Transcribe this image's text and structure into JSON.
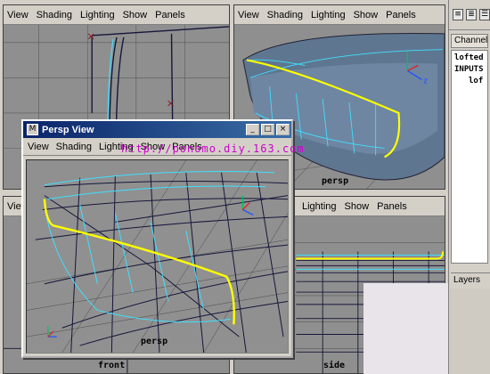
{
  "panels": {
    "top_left": {
      "menu": [
        "View",
        "Shading",
        "Lighting",
        "Show",
        "Panels"
      ]
    },
    "top_right": {
      "menu": [
        "View",
        "Shading",
        "Lighting",
        "Show",
        "Panels"
      ],
      "camera_label": "persp"
    },
    "bottom_left": {
      "menu": [
        "View"
      ],
      "camera_label": "front"
    },
    "bottom_right": {
      "menu": [
        "Lighting",
        "Show",
        "Panels"
      ],
      "camera_label": "side"
    }
  },
  "channel_box": {
    "icons": [
      "channels-icon",
      "attributes-icon",
      "list-icon"
    ],
    "tab_label": "Channels",
    "lines": [
      "lofted",
      "INPUTS",
      "lof"
    ],
    "layers_label": "Layers"
  },
  "floating_window": {
    "title": "Persp View",
    "buttons": [
      "_",
      "□",
      "×"
    ],
    "menu": [
      "View",
      "Shading",
      "Lighting",
      "Show",
      "Panels"
    ],
    "watermark": "http://ponomo.diy.163.com",
    "camera_label": "persp"
  },
  "colors": {
    "viewport_bg": "#8f8f8f",
    "wire_cyan": "#3fe0ff",
    "wire_navy": "#15153a",
    "highlight_yellow": "#ffff00",
    "title_bar": "#0a246a",
    "watermark": "#cc00cc"
  }
}
